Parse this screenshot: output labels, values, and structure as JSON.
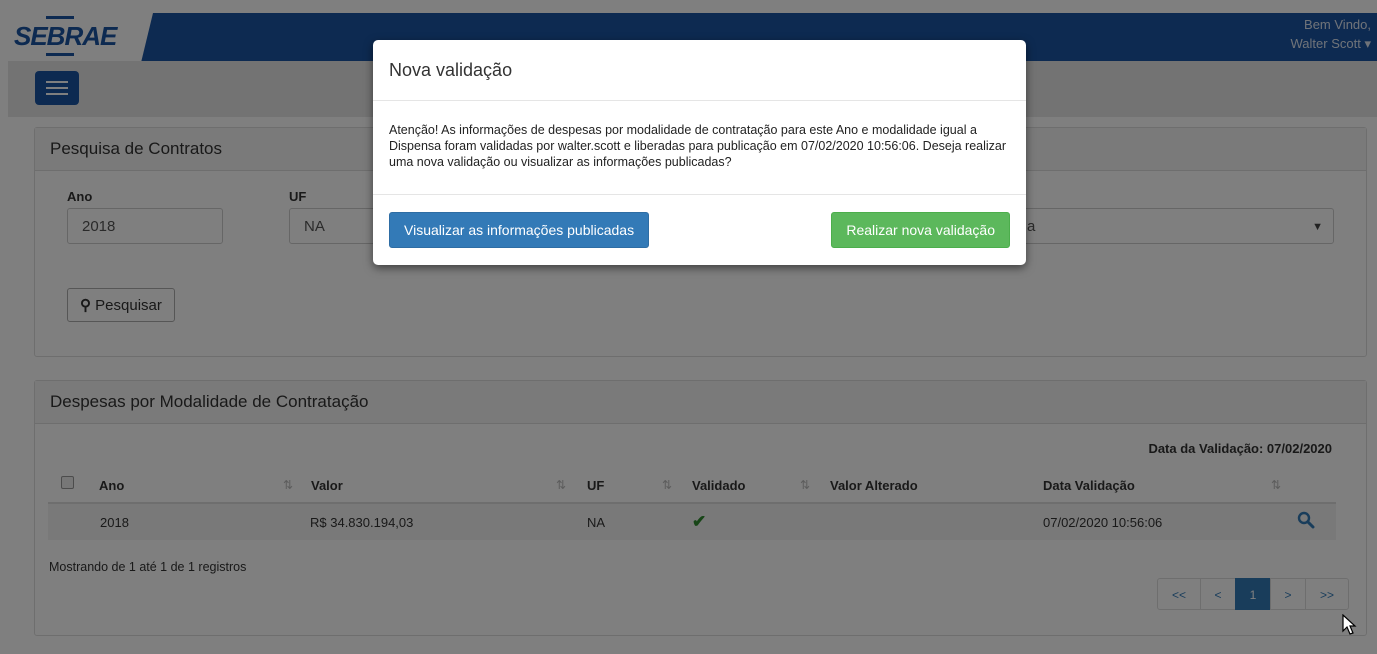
{
  "header": {
    "logo_text": "SEBRAE",
    "welcome_line1": "Bem Vindo,",
    "welcome_line2": "Walter Scott"
  },
  "search_panel": {
    "title": "Pesquisa de Contratos",
    "ano_label": "Ano",
    "ano_value": "2018",
    "uf_label": "UF",
    "uf_value": "NA",
    "modalidade_partial": "a",
    "search_button": "Pesquisar"
  },
  "results_panel": {
    "title": "Despesas por Modalidade de Contratação",
    "validation_date_label": "Data da Validação: 07/02/2020",
    "columns": [
      "Ano",
      "Valor",
      "UF",
      "Validado",
      "Valor Alterado",
      "Data Validação"
    ],
    "rows": [
      {
        "ano": "2018",
        "valor": "R$ 34.830.194,03",
        "uf": "NA",
        "validado": "✔",
        "valor_alterado": "",
        "data_validacao": "07/02/2020 10:56:06"
      }
    ],
    "footer_text": "Mostrando de 1 até 1 de 1 registros",
    "pagination": [
      "<<",
      "<",
      "1",
      ">",
      ">>"
    ]
  },
  "modal": {
    "title": "Nova validação",
    "body": "Atenção! As informações de despesas por modalidade de contratação para este Ano e modalidade igual a Dispensa foram validadas por walter.scott e liberadas para publicação em 07/02/2020 10:56:06. Deseja realizar uma nova validação ou visualizar as informações publicadas?",
    "primary_button": "Visualizar as informações publicadas",
    "success_button": "Realizar nova validação"
  },
  "colors": {
    "brand": "#1a55a3",
    "primary": "#337ab7",
    "success": "#5cb85c",
    "check": "#2e8b2e"
  }
}
